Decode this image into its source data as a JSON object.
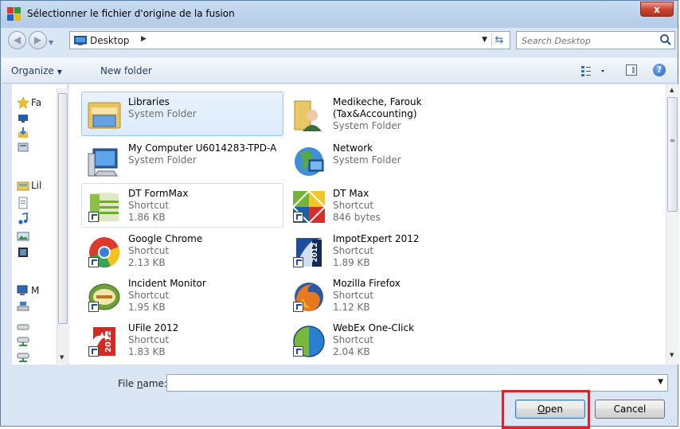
{
  "window": {
    "title": "Sélectionner le fichier d'origine de la fusion",
    "close_label": "x"
  },
  "address": {
    "location": "Desktop",
    "search_placeholder": "Search Desktop"
  },
  "toolbar": {
    "organize_label": "Organize",
    "new_folder_label": "New folder"
  },
  "nav_pane": {
    "items": [
      {
        "label": "Fa",
        "icon": "star-icon"
      },
      {
        "label": "",
        "icon": "desktop-icon"
      },
      {
        "label": "",
        "icon": "downloads-icon"
      },
      {
        "label": "",
        "icon": "recent-places-icon"
      },
      {
        "label": "Lil",
        "icon": "libraries-icon"
      },
      {
        "label": "",
        "icon": "documents-icon"
      },
      {
        "label": "",
        "icon": "music-icon"
      },
      {
        "label": "",
        "icon": "pictures-icon"
      },
      {
        "label": "",
        "icon": "videos-icon"
      },
      {
        "label": "M",
        "icon": "computer-icon"
      },
      {
        "label": "",
        "icon": "local-disk-icon"
      },
      {
        "label": "",
        "icon": "drive-icon"
      },
      {
        "label": "",
        "icon": "network-drive-icon"
      },
      {
        "label": "",
        "icon": "network-drive-icon"
      }
    ]
  },
  "files": [
    {
      "name": "Libraries",
      "type": "System Folder",
      "size": "",
      "icon": "libraries-icon",
      "state": "selected"
    },
    {
      "name": "Medikeche, Farouk (Tax&Accounting)",
      "type": "System Folder",
      "size": "",
      "icon": "user-folder-icon",
      "state": ""
    },
    {
      "name": "My Computer U6014283-TPD-A",
      "type": "System Folder",
      "size": "",
      "icon": "computer-icon",
      "state": ""
    },
    {
      "name": "Network",
      "type": "System Folder",
      "size": "",
      "icon": "network-icon",
      "state": ""
    },
    {
      "name": "DT FormMax",
      "type": "Shortcut",
      "size": "1.86 KB",
      "icon": "dt-formmax-icon",
      "state": "hover"
    },
    {
      "name": "DT Max",
      "type": "Shortcut",
      "size": "846 bytes",
      "icon": "dt-max-icon",
      "state": ""
    },
    {
      "name": "Google Chrome",
      "type": "Shortcut",
      "size": "2.13 KB",
      "icon": "chrome-icon",
      "state": ""
    },
    {
      "name": "ImpotExpert 2012",
      "type": "Shortcut",
      "size": "1.89 KB",
      "icon": "impotexpert-icon",
      "state": ""
    },
    {
      "name": "Incident Monitor",
      "type": "Shortcut",
      "size": "1.95 KB",
      "icon": "incident-monitor-icon",
      "state": ""
    },
    {
      "name": "Mozilla Firefox",
      "type": "Shortcut",
      "size": "1.12 KB",
      "icon": "firefox-icon",
      "state": ""
    },
    {
      "name": "UFile 2012",
      "type": "Shortcut",
      "size": "1.83 KB",
      "icon": "ufile-icon",
      "state": ""
    },
    {
      "name": "WebEx One-Click",
      "type": "Shortcut",
      "size": "2.04 KB",
      "icon": "webex-icon",
      "state": ""
    }
  ],
  "footer": {
    "file_name_label_pre": "File ",
    "file_name_label_u": "n",
    "file_name_label_post": "ame:",
    "file_name_value": "",
    "open_label_u": "O",
    "open_label_rest": "pen",
    "cancel_label": "Cancel"
  },
  "colors": {
    "selection": "#dcebfc",
    "highlight_box": "#e2202a",
    "accent": "#1f5fb5"
  }
}
